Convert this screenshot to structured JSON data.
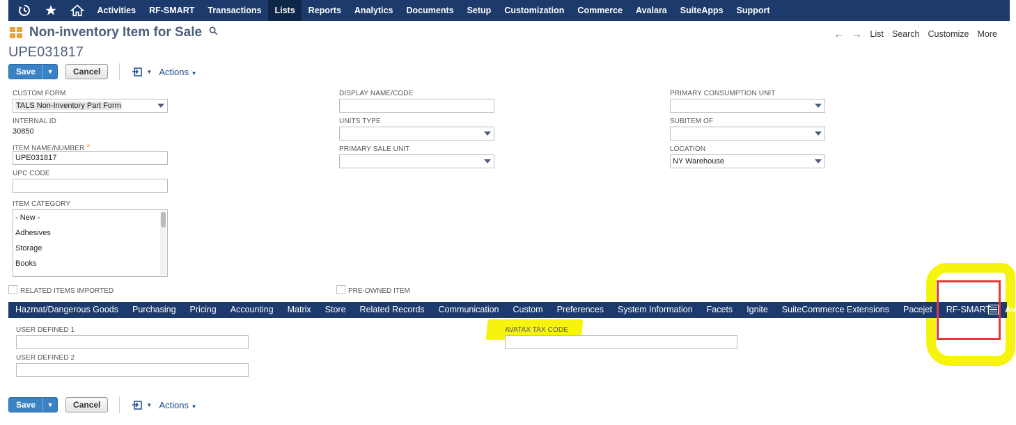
{
  "topnav": {
    "icons": [
      "recent-icon",
      "star-icon",
      "home-icon"
    ],
    "items": [
      "Activities",
      "RF-SMART",
      "Transactions",
      "Lists",
      "Reports",
      "Analytics",
      "Documents",
      "Setup",
      "Customization",
      "Commerce",
      "Avalara",
      "SuiteApps",
      "Support"
    ],
    "active": "Lists",
    "colors": {
      "bar": "#1c3a6b",
      "active": "#0d2547"
    }
  },
  "header": {
    "title": "Non-inventory Item for Sale",
    "record_id": "UPE031817",
    "nav": {
      "list": "List",
      "search": "Search",
      "customize": "Customize",
      "more": "More"
    }
  },
  "buttons": {
    "save": "Save",
    "cancel": "Cancel",
    "actions": "Actions"
  },
  "form": {
    "custom_form": {
      "label": "CUSTOM FORM",
      "value": "TALS Non-Inventory Part Form"
    },
    "internal_id": {
      "label": "INTERNAL ID",
      "value": "30850"
    },
    "item_name": {
      "label": "ITEM NAME/NUMBER",
      "value": "UPE031817",
      "required": true
    },
    "upc_code": {
      "label": "UPC CODE",
      "value": ""
    },
    "item_category": {
      "label": "ITEM CATEGORY",
      "options": [
        "- New -",
        "Adhesives",
        "Storage",
        "Books"
      ]
    },
    "related_items_imported": {
      "label": "RELATED ITEMS IMPORTED",
      "checked": false
    },
    "display_name": {
      "label": "DISPLAY NAME/CODE",
      "value": ""
    },
    "units_type": {
      "label": "UNITS TYPE",
      "value": ""
    },
    "primary_sale_unit": {
      "label": "PRIMARY SALE UNIT",
      "value": ""
    },
    "pre_owned_item": {
      "label": "PRE-OWNED ITEM",
      "checked": false
    },
    "primary_consumption_unit": {
      "label": "PRIMARY CONSUMPTION UNIT",
      "value": ""
    },
    "subitem_of": {
      "label": "SUBITEM OF",
      "value": ""
    },
    "location": {
      "label": "LOCATION",
      "value": "NY Warehouse"
    }
  },
  "subtabs": {
    "items": [
      "Hazmat/Dangerous Goods",
      "Purchasing",
      "Pricing",
      "Accounting",
      "Matrix",
      "Store",
      "Related Records",
      "Communication",
      "Custom",
      "Preferences",
      "System Information",
      "Facets",
      "Ignite",
      "SuiteCommerce Extensions",
      "Pacejet",
      "RF-SMART",
      "AvaTax"
    ],
    "active": "AvaTax"
  },
  "avatax": {
    "user_defined_1": {
      "label": "USER DEFINED 1",
      "value": ""
    },
    "user_defined_2": {
      "label": "USER DEFINED 2",
      "value": ""
    },
    "avatax_tax_code": {
      "label": "AVATAX TAX CODE",
      "value": ""
    }
  },
  "annotations": {
    "highlight_color": "#f6f40f",
    "box_color": "#e03a3a"
  }
}
